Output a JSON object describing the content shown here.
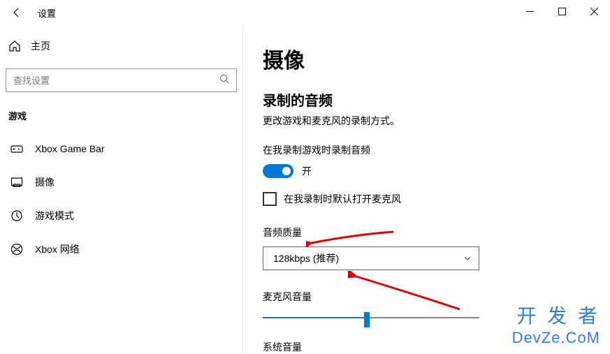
{
  "titlebar": {
    "title": "设置"
  },
  "sidebar": {
    "home": "主页",
    "search_placeholder": "查找设置",
    "section": "游戏",
    "items": [
      {
        "label": "Xbox Game Bar"
      },
      {
        "label": "摄像"
      },
      {
        "label": "游戏模式"
      },
      {
        "label": "Xbox 网络"
      }
    ]
  },
  "main": {
    "title": "摄像",
    "audio_section": "录制的音频",
    "audio_desc": "更改游戏和麦克风的录制方式。",
    "record_audio_label": "在我录制游戏时录制音频",
    "toggle_state": "开",
    "mic_default_label": "在我录制时默认打开麦克风",
    "audio_quality_label": "音频质量",
    "audio_quality_value": "128kbps (推荐)",
    "mic_volume_label": "麦克风音量",
    "system_volume_label": "系统音量"
  },
  "watermark": {
    "line1": "开 发 者",
    "line2": "DevZe.CoM"
  }
}
